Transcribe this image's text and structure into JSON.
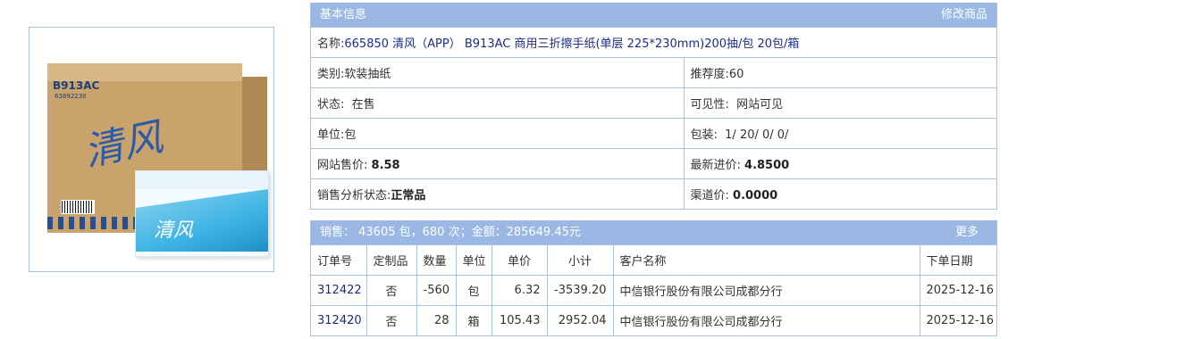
{
  "product_image": {
    "box_code": "B913AC",
    "box_sub": "63892230",
    "brand_text": "清风"
  },
  "basic": {
    "header_title": "基本信息",
    "edit_link": "修改商品",
    "name_label": "名称:",
    "name_value": "665850 清风（APP） B913AC 商用三折擦手纸(单层 225*230mm)200抽/包 20包/箱",
    "category_label": "类别:",
    "category_value": "软装抽纸",
    "recommend_label": "推荐度:",
    "recommend_value": "60",
    "status_label": "状态:",
    "status_value": "在售",
    "visibility_label": "可见性:",
    "visibility_value": "网站可见",
    "unit_label": "单位:",
    "unit_value": "包",
    "package_label": "包装:",
    "package_value": "1/ 20/ 0/ 0/",
    "price_label": "网站售价:",
    "price_value": "8.58",
    "cost_label": "最新进价:",
    "cost_value": "4.8500",
    "analysis_label": "销售分析状态:",
    "analysis_value": "正常品",
    "channel_label": "渠道价:",
    "channel_value": "0.0000"
  },
  "sales": {
    "summary": "销售： 43605 包，680 次；金额：285649.45元",
    "more_link": "更多",
    "columns": [
      "订单号",
      "定制品",
      "数量",
      "单位",
      "单价",
      "小计",
      "客户名称",
      "下单日期"
    ],
    "rows": [
      {
        "order": "312422",
        "custom": "否",
        "qty": "-560",
        "unit": "包",
        "price": "6.32",
        "subtotal": "-3539.20",
        "customer": "中信银行股份有限公司成都分行",
        "date": "2025-12-16"
      },
      {
        "order": "312420",
        "custom": "否",
        "qty": "28",
        "unit": "箱",
        "price": "105.43",
        "subtotal": "2952.04",
        "customer": "中信银行股份有限公司成都分行",
        "date": "2025-12-16"
      }
    ]
  }
}
